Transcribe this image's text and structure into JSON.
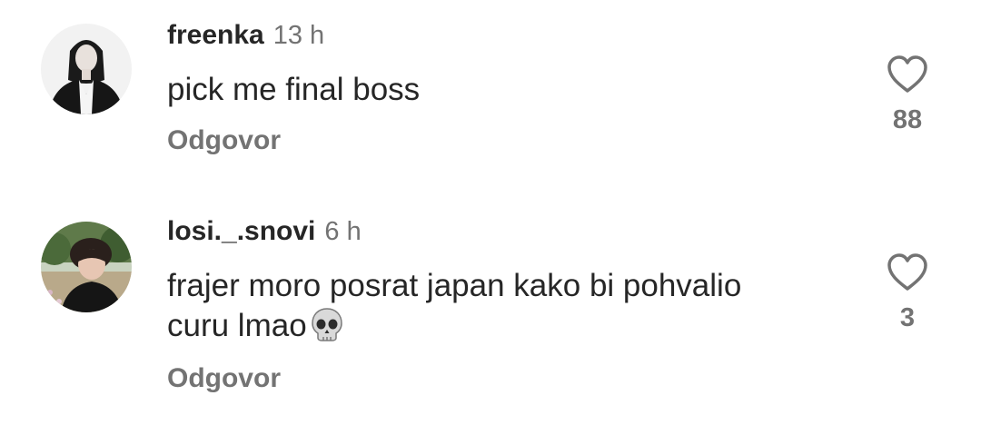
{
  "comments": [
    {
      "username": "freenka",
      "time": "13 h",
      "text": "pick me final boss",
      "reply_label": "Odgovor",
      "like_count": "88",
      "icon": "heart-outline-icon"
    },
    {
      "username": "losi._.snovi",
      "time": "6 h",
      "text_line1": "frajer moro posrat japan kako bi pohvalio",
      "text_line2": "curu lmao",
      "emoji": "skull-emoji",
      "reply_label": "Odgovor",
      "like_count": "3",
      "icon": "heart-outline-icon"
    }
  ],
  "colors": {
    "primary_text": "#262626",
    "secondary_text": "#737373",
    "background": "#ffffff"
  }
}
